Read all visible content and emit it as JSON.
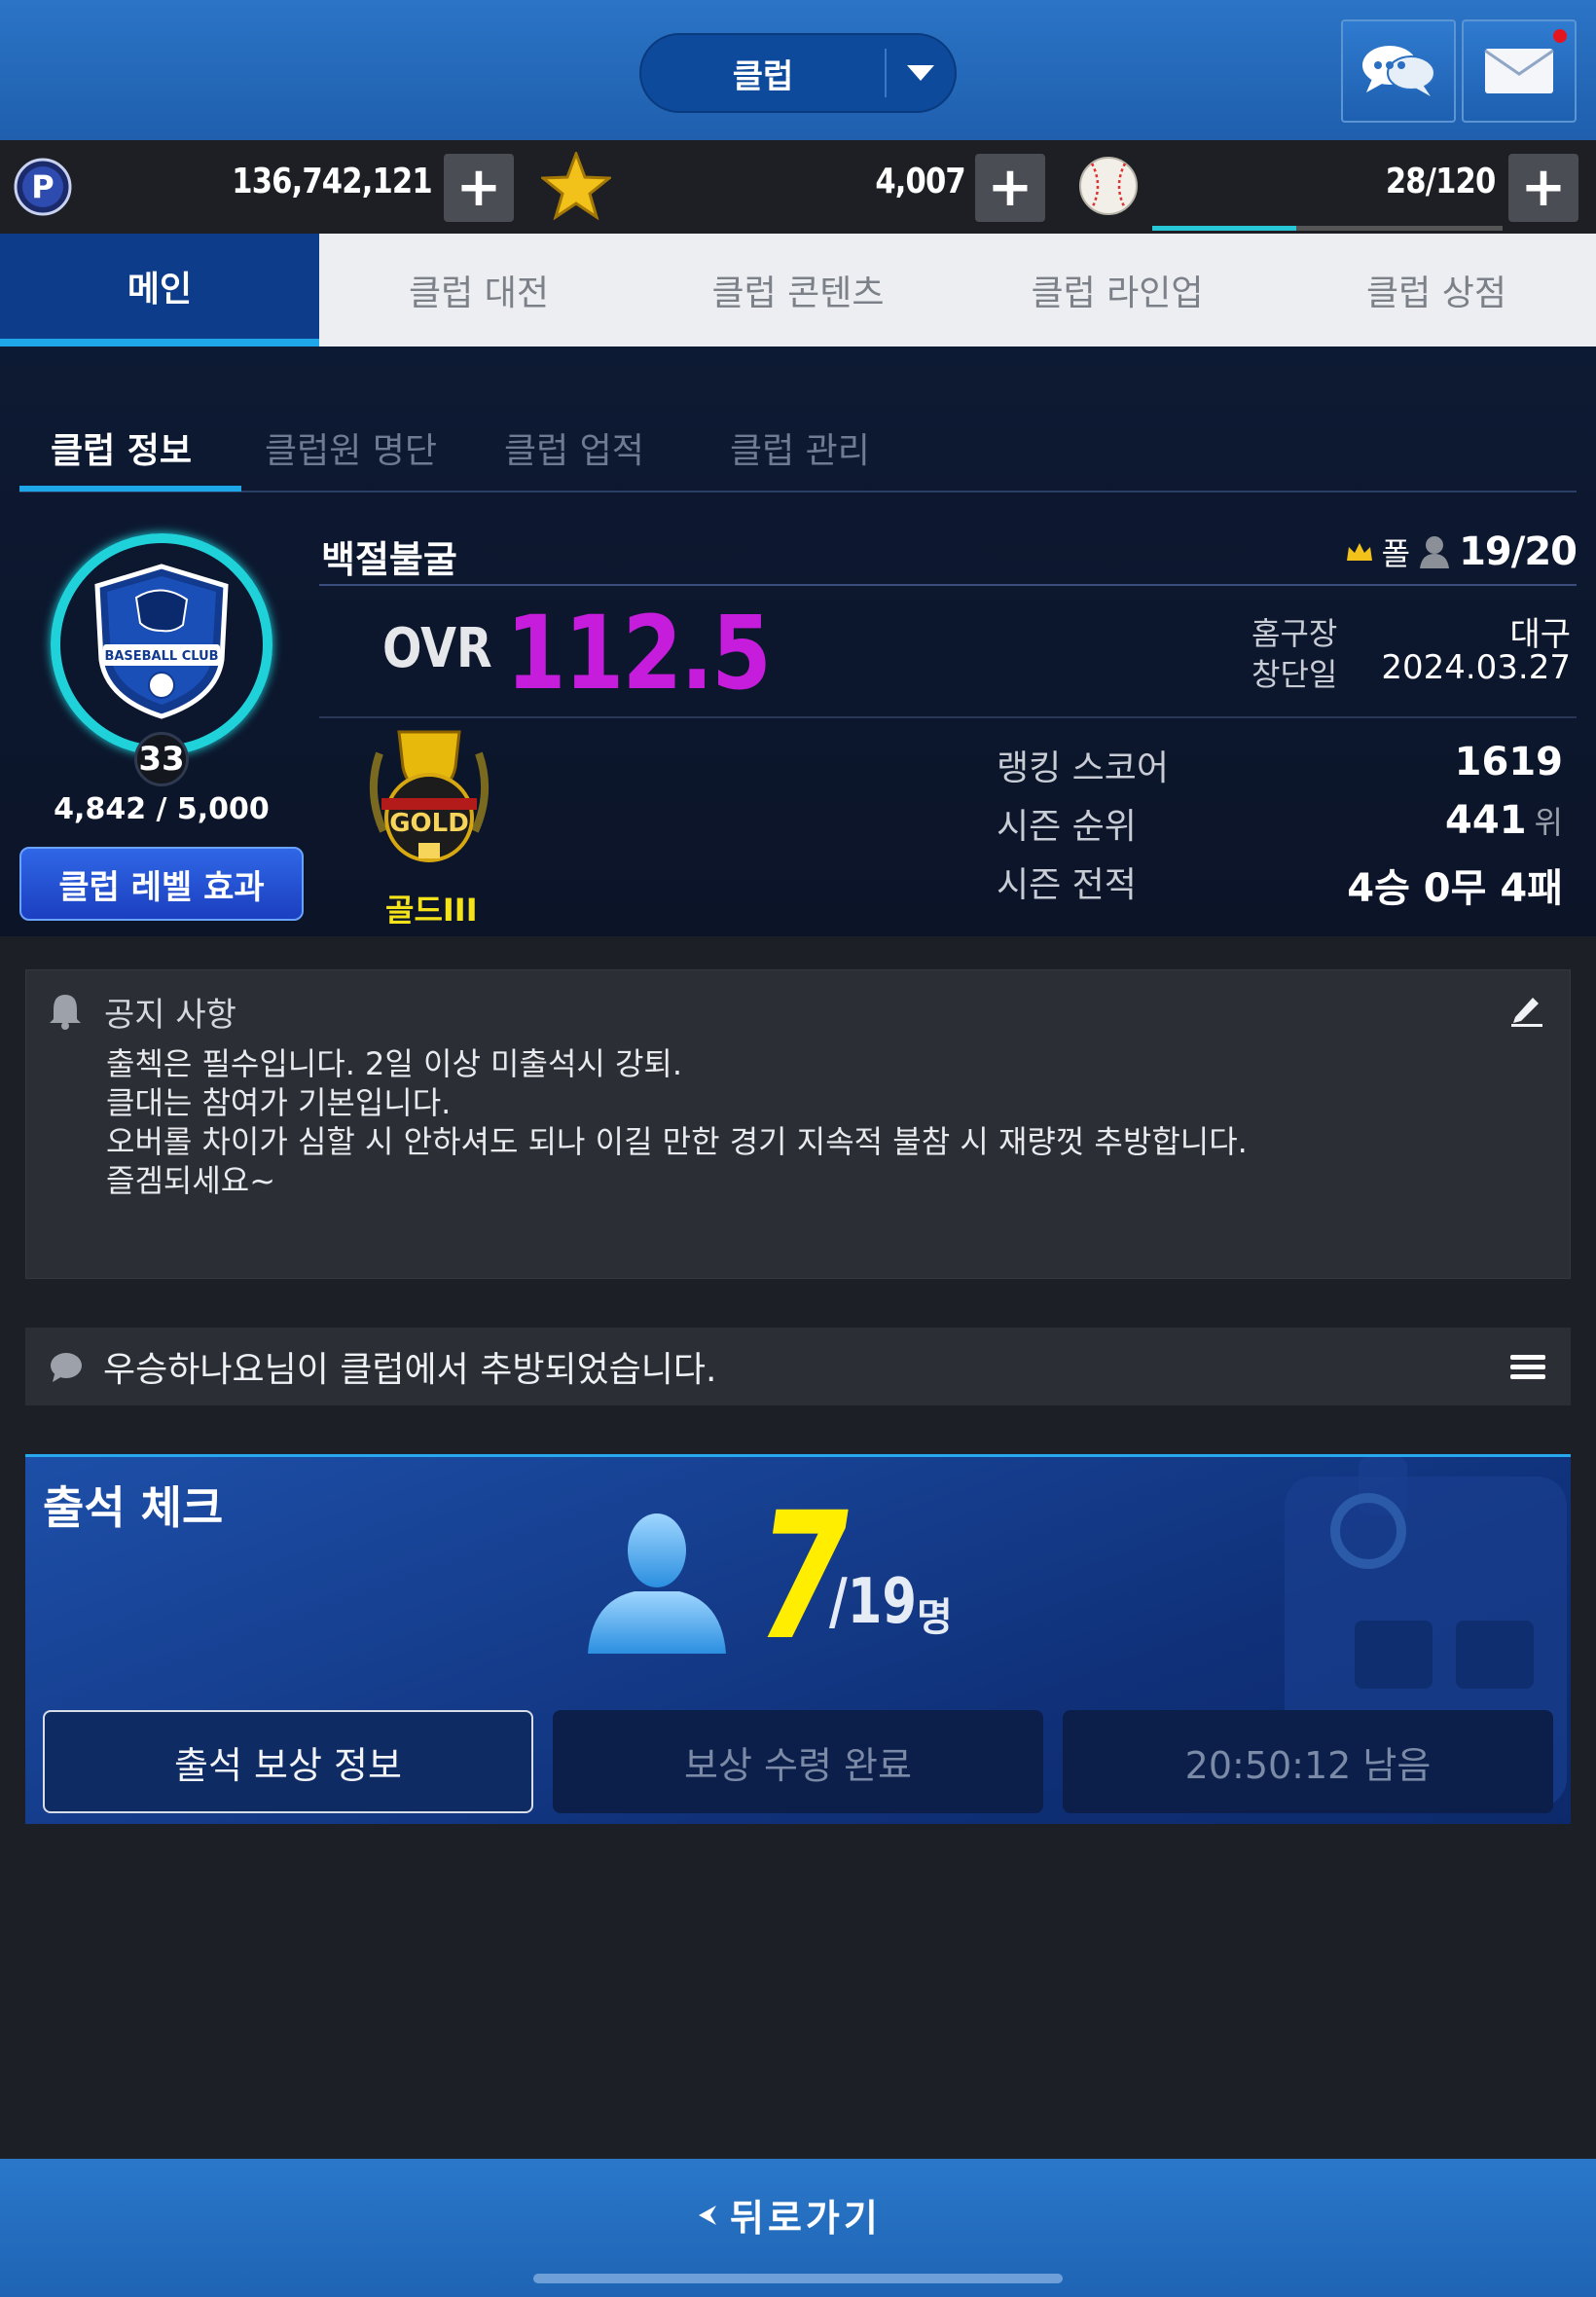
{
  "header": {
    "dropdown_label": "클럽"
  },
  "currency": {
    "points": "136,742,121",
    "stars": "4,007",
    "stamina": "28/120",
    "stamina_fraction": 0.41
  },
  "main_tabs": [
    {
      "label": "메인"
    },
    {
      "label": "클럽 대전"
    },
    {
      "label": "클럽 콘텐츠"
    },
    {
      "label": "클럽 라인업"
    },
    {
      "label": "클럽 상점"
    }
  ],
  "sub_tabs": [
    {
      "label": "클럽 정보"
    },
    {
      "label": "클럽원 명단"
    },
    {
      "label": "클럽 업적"
    },
    {
      "label": "클럽 관리"
    }
  ],
  "club": {
    "emblem_text": "BASEBALL CLUB",
    "level": "33",
    "exp": "4,842 / 5,000",
    "level_button": "클럽 레벨 효과",
    "name": "백절불굴",
    "leader": "폴",
    "members": "19/20",
    "ovr_label": "OVR",
    "ovr_value": "112.5",
    "home_label": "홈구장",
    "home_value": "대구",
    "founded_label": "창단일",
    "founded_value": "2024.03.27",
    "tier_badge_text": "GOLD",
    "tier": "골드III",
    "ranking_score_label": "랭킹 스코어",
    "ranking_score": "1619",
    "season_rank_label": "시즌 순위",
    "season_rank": "441",
    "season_rank_unit": "위",
    "season_record_label": "시즌 전적",
    "season_record": "4승 0무 4패"
  },
  "notice": {
    "title": "공지 사항",
    "lines": [
      "출첵은 필수입니다. 2일 이상 미출석시 강퇴.",
      "클대는 참여가 기본입니다.",
      "오버롤 차이가 심할 시 안하셔도 되나 이길 만한 경기 지속적 불참 시 재량껏 추방합니다.",
      "즐겜되세요~"
    ]
  },
  "feed": {
    "text": "우승하나요님이 클럽에서 추방되었습니다."
  },
  "attendance": {
    "title": "출석 체크",
    "count": "7",
    "total": "/19",
    "unit": "명",
    "buttons": [
      {
        "label": "출석 보상 정보"
      },
      {
        "label": "보상 수령 완료"
      },
      {
        "label": "20:50:12 남음"
      }
    ]
  },
  "footer": {
    "back_label": "뒤로가기"
  },
  "colors": {
    "accent": "#1ea7e8",
    "ovr": "#c61ddc",
    "attend_count": "#ffee00",
    "tier": "#f4e21a"
  }
}
